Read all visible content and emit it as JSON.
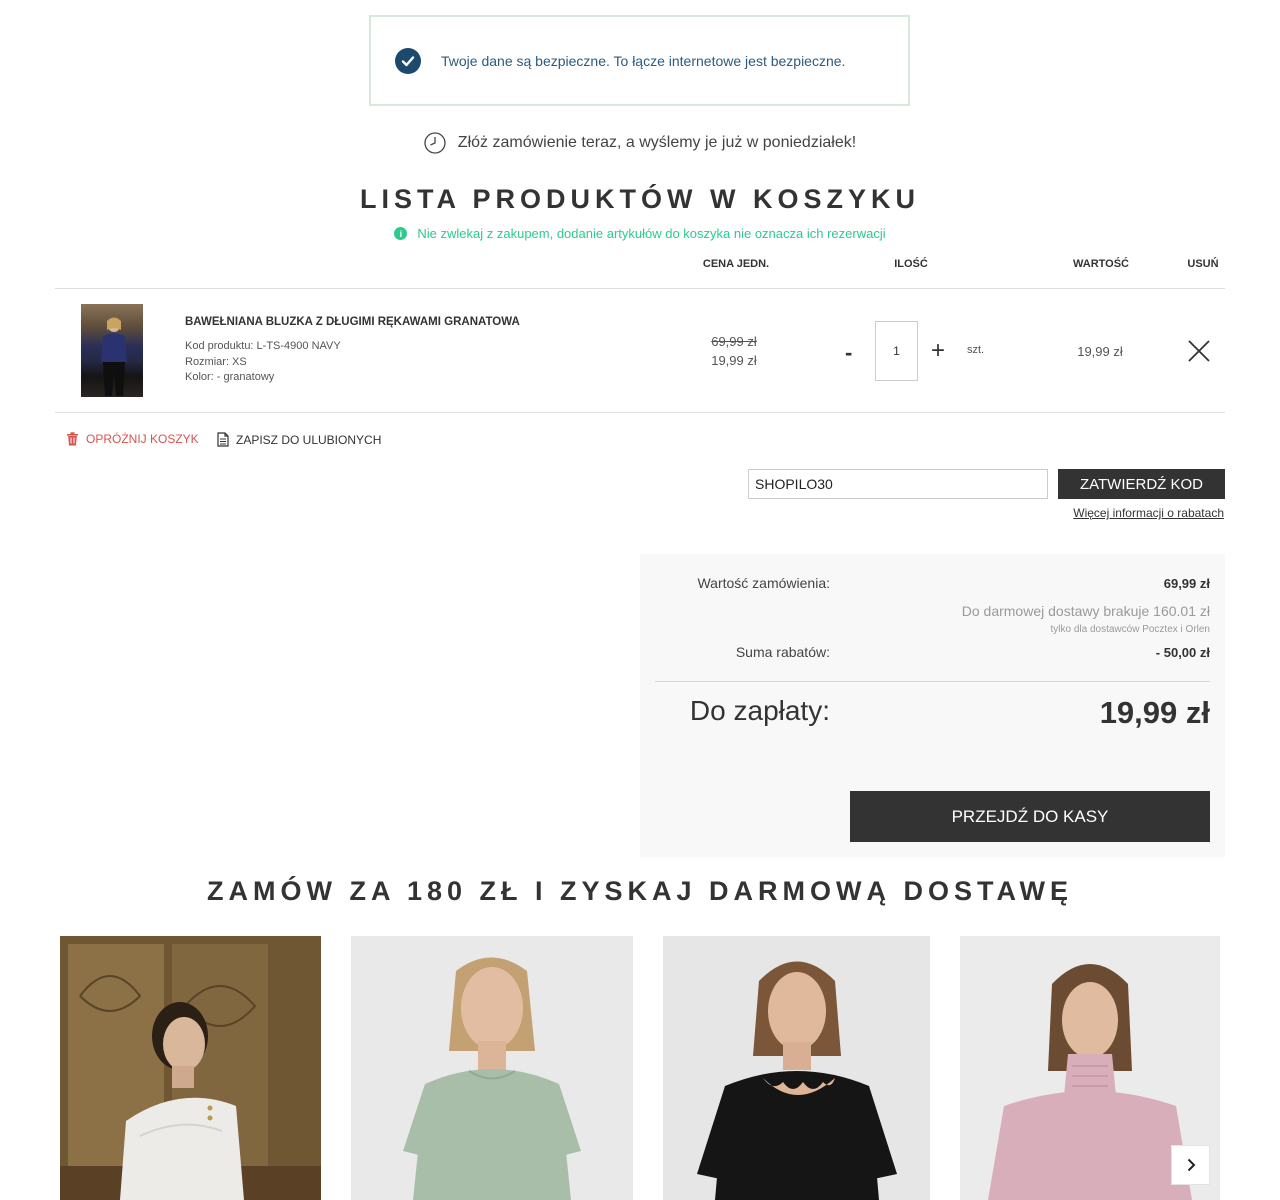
{
  "security": {
    "text": "Twoje dane są bezpieczne. To łącze internetowe jest bezpieczne."
  },
  "shipping": {
    "text": "Złóż zamówienie teraz, a wyślemy je już w poniedziałek!"
  },
  "cart": {
    "title": "LISTA PRODUKTÓW W KOSZYKU",
    "notice": "Nie zwlekaj z zakupem, dodanie artykułów do koszyka nie oznacza ich rezerwacji",
    "columns": {
      "unit_price": "CENA JEDN.",
      "quantity": "ILOŚĆ",
      "value": "WARTOŚĆ",
      "remove": "USUŃ"
    },
    "items": [
      {
        "name": "BAWEŁNIANA BLUZKA Z DŁUGIMI RĘKAWAMI GRANATOWA",
        "code": "Kod produktu: L-TS-4900 NAVY",
        "size": "Rozmiar: XS",
        "color": "Kolor: - granatowy",
        "old_price": "69,99 zł",
        "price": "19,99 zł",
        "quantity": "1",
        "unit": "szt.",
        "value": "19,99 zł",
        "minus": "-",
        "plus": "+"
      }
    ],
    "actions": {
      "empty": "OPRÓŻNIJ KOSZYK",
      "save": "ZAPISZ DO ULUBIONYCH"
    }
  },
  "coupon": {
    "value": "SHOPILO30",
    "button": "ZATWIERDŹ KOD",
    "more_link": "Więcej informacji o rabatach"
  },
  "summary": {
    "order_value_label": "Wartość zamówienia:",
    "order_value": "69,99 zł",
    "free_shipping_note": "Do darmowej dostawy brakuje 160.01 zł",
    "carriers_note": "tylko dla dostawców Pocztex i Orlen",
    "discount_label": "Suma rabatów:",
    "discount_value": "- 50,00 zł",
    "to_pay_label": "Do zapłaty:",
    "to_pay_value": "19,99 zł",
    "checkout_button": "PRZEJDŹ DO KASY"
  },
  "recommendations": {
    "title": "ZAMÓW ZA 180 ZŁ I ZYSKAJ DARMOWĄ DOSTAWĘ",
    "products": [
      {
        "color": "#ecebe8",
        "bg": "#6f5733"
      },
      {
        "color": "#a8bea8",
        "bg": "#e9e9e9"
      },
      {
        "color": "#151515",
        "bg": "#e6e6e6"
      },
      {
        "color": "#d9aebb",
        "bg": "#ebebeb"
      }
    ]
  },
  "colors": {
    "accent_green": "#2bcb8e",
    "secure_blue": "#1d4a6c",
    "dark_button": "#333333",
    "danger": "#d9534f"
  }
}
